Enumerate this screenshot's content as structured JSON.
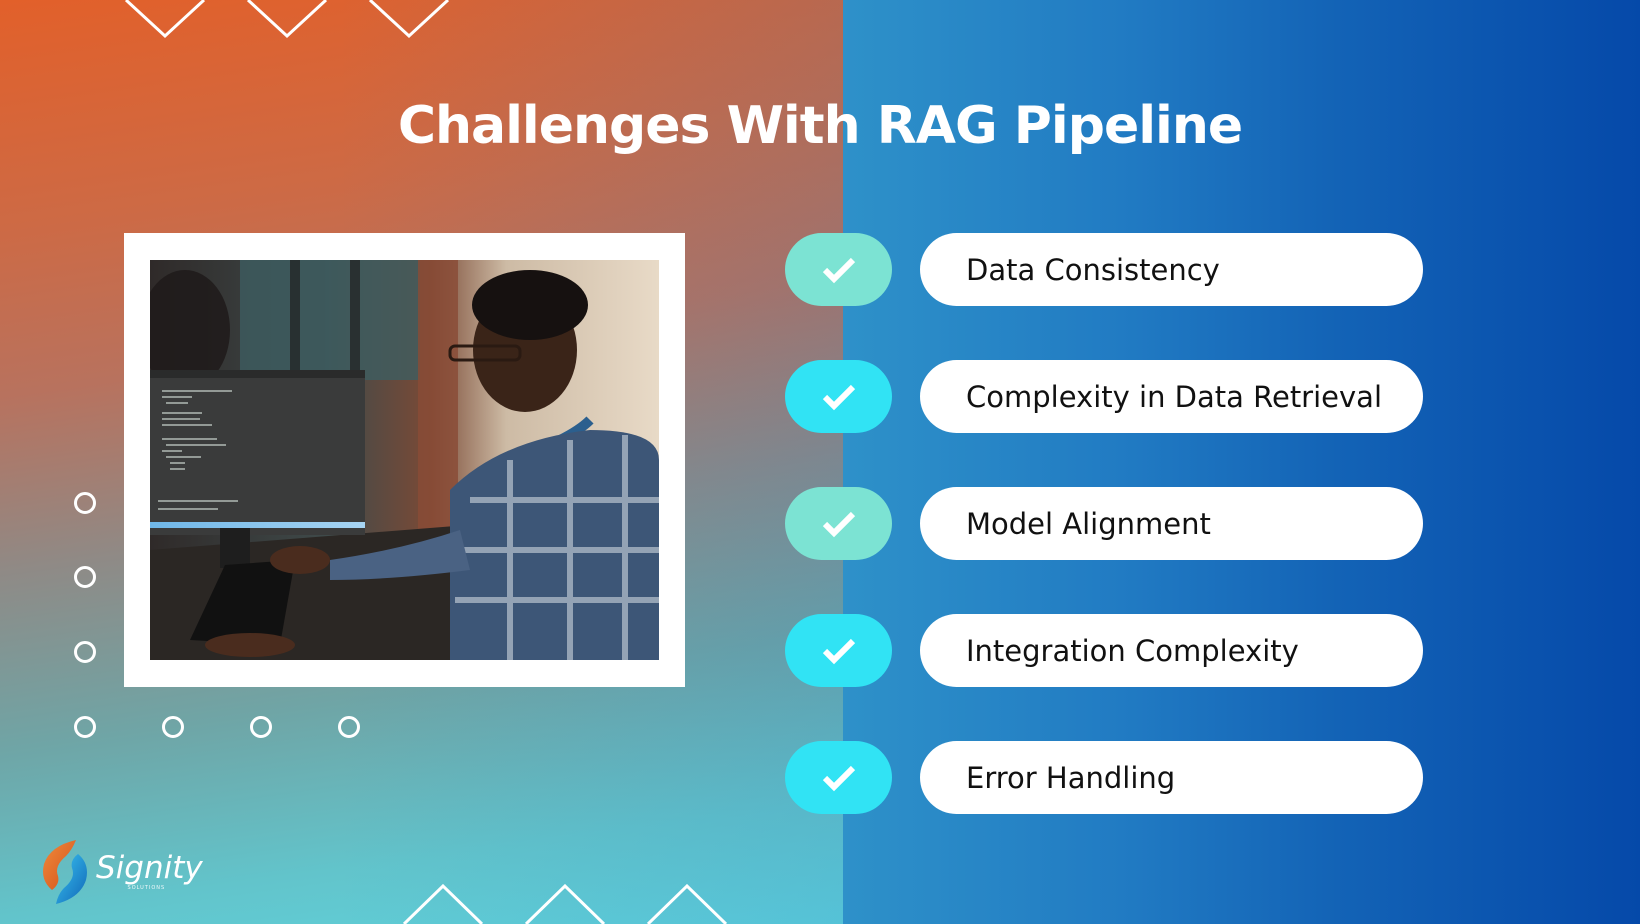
{
  "slide": {
    "title": "Challenges With RAG Pipeline",
    "colors": {
      "left_top": "#e2602a",
      "left_bottom": "#5fd3dd",
      "right_left": "#2e91c9",
      "right_right": "#0549a9",
      "check_teal": "#7ce3d3",
      "check_cyan": "#31e3f4",
      "pill_bg": "#ffffff",
      "pill_text": "#111111"
    }
  },
  "photo": {
    "alt": "Smiling developer with glasses and headphones around neck, wearing a plaid shirt, typing code at a computer monitor"
  },
  "challenges": [
    {
      "label": "Data Consistency",
      "icon": "check-icon",
      "color": "#7ce3d3"
    },
    {
      "label": "Complexity in Data Retrieval",
      "icon": "check-icon",
      "color": "#31e3f4"
    },
    {
      "label": "Model Alignment",
      "icon": "check-icon",
      "color": "#7ce3d3"
    },
    {
      "label": "Integration Complexity",
      "icon": "check-icon",
      "color": "#31e3f4"
    },
    {
      "label": "Error Handling",
      "icon": "check-icon",
      "color": "#31e3f4"
    }
  ],
  "logo": {
    "name": "Signity",
    "tagline": "SOLUTIONS"
  }
}
